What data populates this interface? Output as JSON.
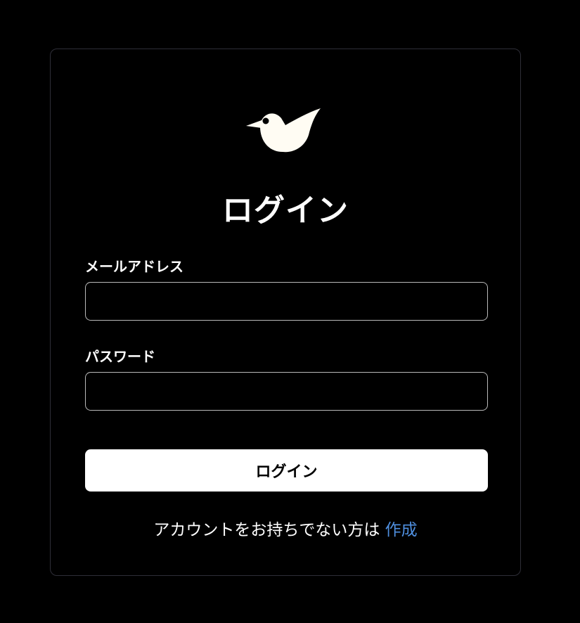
{
  "logo": {
    "icon": "bird-icon",
    "color": "#fffcf3"
  },
  "title": "ログイン",
  "email": {
    "label": "メールアドレス",
    "value": "",
    "placeholder": ""
  },
  "password": {
    "label": "パスワード",
    "value": "",
    "placeholder": ""
  },
  "submit_label": "ログイン",
  "signup": {
    "prompt": "アカウントをお持ちでない方は ",
    "link_label": "作成",
    "link_color": "#4f8fdf"
  }
}
